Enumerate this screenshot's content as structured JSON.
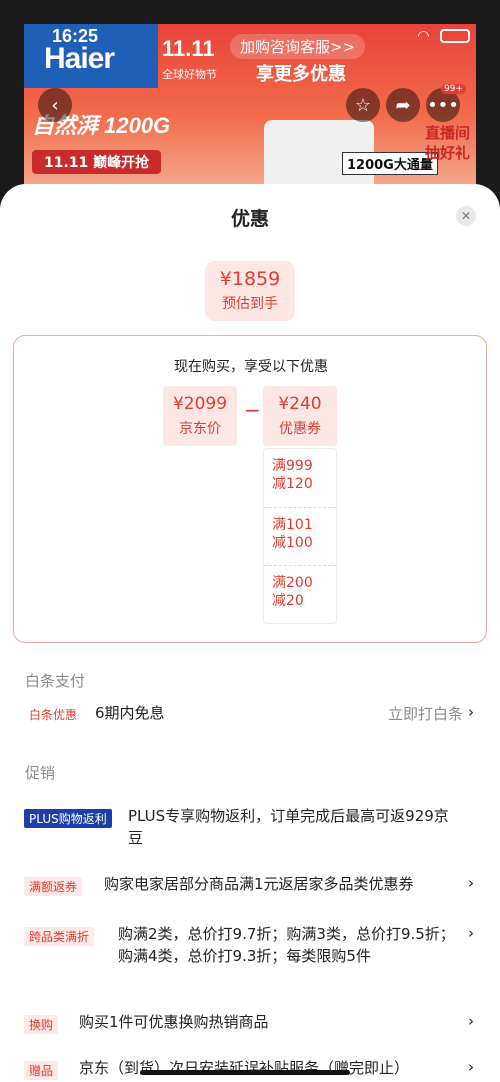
{
  "background": {
    "status_time": "16:25",
    "brand_logo": "Haier",
    "promo_logo": "11.11",
    "promo_sub": "全球好物节",
    "consult_pill": "加购咨询客服>>",
    "more_deal": "享更多优惠",
    "headline": "自然湃 1200G",
    "chip": "11.11 巅峰开抢",
    "product_label": "1200G大通量",
    "live_text_1": "直播间",
    "live_text_2": "抽好礼",
    "badge": "99+",
    "icons": {
      "back": "back-arrow-icon",
      "star": "star-icon",
      "share": "share-icon",
      "more": "more-icon"
    }
  },
  "sheet": {
    "title": "优惠",
    "final_price": {
      "amount": "¥1859",
      "label": "预估到手"
    },
    "breakdown": {
      "title": "现在购买，享受以下优惠",
      "jd_price": {
        "amount": "¥2099",
        "label": "京东价"
      },
      "coupon": {
        "amount": "¥240",
        "label": "优惠券"
      },
      "coupon_items": [
        {
          "line1": "满999",
          "line2": "减120"
        },
        {
          "line1": "满101",
          "line2": "减100"
        },
        {
          "line1": "满200",
          "line2": "减20"
        }
      ]
    },
    "baitiao": {
      "section_title": "白条支付",
      "tag": "白条优惠",
      "text": "6期内免息",
      "action": "立即打白条"
    },
    "promotions": {
      "section_title": "促销",
      "items": [
        {
          "tag": "PLUS购物返利",
          "text": "PLUS专享购物返利，订单完成后最高可返929京豆"
        },
        {
          "tag": "满额返券",
          "text": "购家电家居部分商品满1元返居家多品类优惠券"
        },
        {
          "tag": "跨品类满折",
          "text": "购满2类，总价打9.7折；购满3类，总价打9.5折；购满4类，总价打9.3折；每类限购5件"
        },
        {
          "tag": "换购",
          "text": "购买1件可优惠换购热销商品"
        },
        {
          "tag": "赠品",
          "text": "京东（到货）次日安装延误补贴服务（赠完即止）"
        }
      ]
    }
  },
  "colors": {
    "accent": "#e23c2e",
    "plus_tag": "#1d3ea8"
  }
}
